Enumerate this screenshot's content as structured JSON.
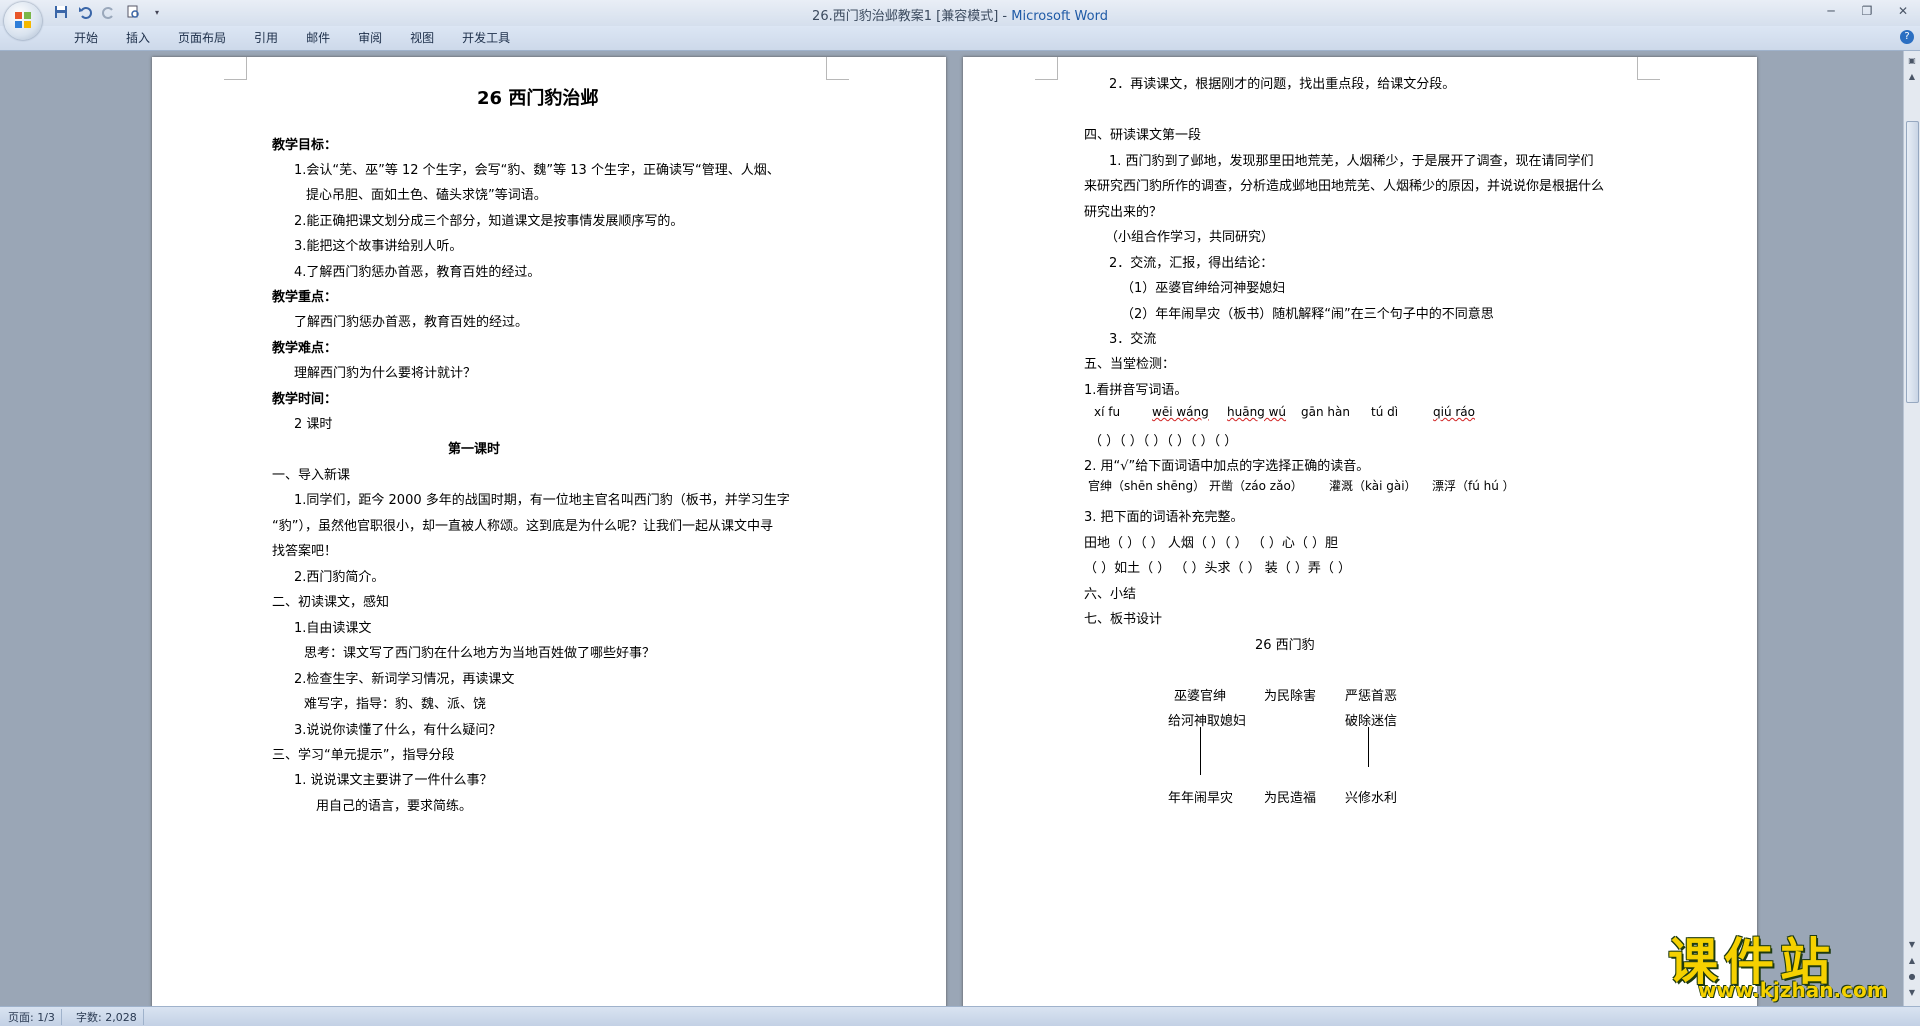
{
  "window": {
    "title_doc": "26.西门豹治邺教案1 [兼容模式] - ",
    "title_app": "Microsoft Word"
  },
  "ribbon": {
    "tabs": [
      "开始",
      "插入",
      "页面布局",
      "引用",
      "邮件",
      "审阅",
      "视图",
      "开发工具"
    ]
  },
  "page1": {
    "title": "26  西门豹治邺",
    "lines": [
      "教学目标：",
      "1.会认“芜、巫”等 12 个生字，会写“豹、魏”等 13 个生字，正确读写“管理、人烟、",
      "提心吊胆、面如土色、磕头求饶”等词语。",
      "2.能正确把课文划分成三个部分，知道课文是按事情发展顺序写的。",
      "3.能把这个故事讲给别人听。",
      "4.了解西门豹惩办首恶，教育百姓的经过。",
      "教学重点：",
      "了解西门豹惩办首恶，教育百姓的经过。",
      "教学难点：",
      "理解西门豹为什么要将计就计？",
      "教学时间：",
      "2 课时",
      "第一课时",
      "一、导入新课",
      "1.同学们，距今 2000 多年的战国时期，有一位地主官名叫西门豹（板书，并学习生字",
      "“豹”），虽然他官职很小，却一直被人称颂。这到底是为什么呢？让我们一起从课文中寻",
      "找答案吧！",
      "2.西门豹简介。",
      "二、初读课文，感知",
      "1.自由读课文",
      "思考：课文写了西门豹在什么地方为当地百姓做了哪些好事？",
      "2.检查生字、新词学习情况，再读课文",
      "难写字，指导：豹、魏、派、饶",
      "3.说说你读懂了什么，有什么疑问？",
      "三、学习“单元提示”，指导分段",
      "1. 说说课文主要讲了一件什么事？",
      "用自己的语言，要求简练。"
    ]
  },
  "page2": {
    "lines": [
      "2．再读课文，根据刚才的问题，找出重点段，给课文分段。",
      "四、研读课文第一段",
      "1. 西门豹到了邺地，发现那里田地荒芜，人烟稀少，于是展开了调查，现在请同学们",
      "来研究西门豹所作的调查，分析造成邺地田地荒芜、人烟稀少的原因，并说说你是根据什么",
      "研究出来的？",
      "（小组合作学习，共同研究）",
      "2．交流，汇报，得出结论：",
      "（1）巫婆官绅给河神娶媳妇",
      "（2）年年闹旱灾（板书）随机解释“闹”在三个句子中的不同意思",
      "3．交流",
      "五、当堂检测：",
      "1.看拼音写词语。",
      "2. 用“√”给下面词语中加点的字选择正确的读音。",
      "3. 把下面的词语补充完整。",
      "六、小结",
      "七、板书设计"
    ],
    "pinyin": [
      "xí fu",
      "wēi wáng",
      "huāng wú",
      "gān hàn",
      "tú dì",
      "qiú ráo"
    ],
    "paren_row": "（      ）（      ）（      ）（      ）（      ）（      ）",
    "readings": [
      "官绅（shēn shēng）",
      "开凿（záo zǎo）",
      "灌溉（kài gài）",
      "漂浮（fú hú ）"
    ],
    "fill_row1": "田地（    ）（    ）   人烟（    ）（    ）   （    ）心（    ）胆",
    "fill_row2": "（    ）如土（    ）   （    ）头求（    ）   装（    ）弄（    ）",
    "board_title": "26   西门豹",
    "board": {
      "top_left_1": "巫婆官绅",
      "top_left_2": "给河神取媳妇",
      "top_mid": "为民除害",
      "top_right_1": "严惩首恶",
      "top_right_2": "破除迷信",
      "bottom_left": "年年闹旱灾",
      "bottom_mid": "为民造福",
      "bottom_right": "兴修水利"
    }
  },
  "status": {
    "page": "页面: 1/3",
    "words": "字数: 2,028"
  },
  "watermark": {
    "main": "课件站",
    "url": "www.kjzhan.com"
  }
}
